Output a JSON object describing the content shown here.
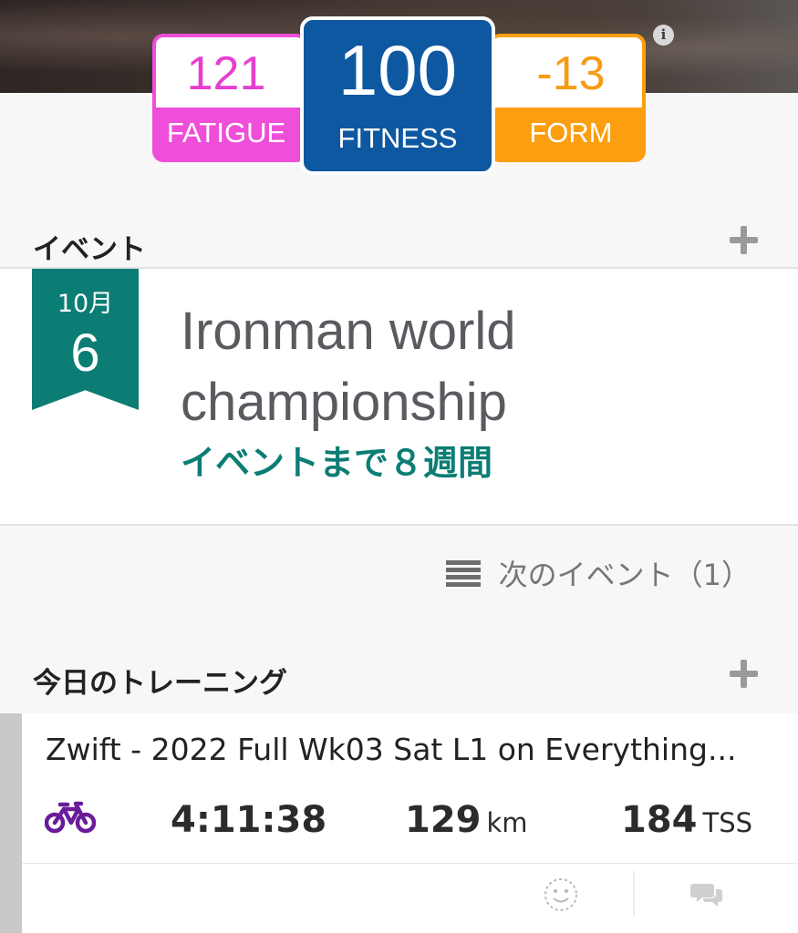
{
  "metrics": {
    "fatigue": {
      "value": "121",
      "label": "FATIGUE",
      "color": "#ee4ed8"
    },
    "fitness": {
      "value": "100",
      "label": "FITNESS",
      "color": "#0e58a1"
    },
    "form": {
      "value": "-13",
      "label": "FORM",
      "color": "#fb9e0f"
    },
    "info_icon": "info-icon"
  },
  "events": {
    "section_title": "イベント",
    "add_icon": "plus-icon",
    "card": {
      "month": "10月",
      "day": "6",
      "name": "Ironman world championship",
      "countdown": "イベントまで８週間",
      "accent_color": "#0c7d74"
    },
    "next_events_label": "次のイベント（1）",
    "list_icon": "list-icon"
  },
  "training": {
    "section_title": "今日のトレーニング",
    "add_icon": "plus-icon",
    "workout": {
      "title": "Zwift - 2022 Full Wk03 Sat L1 on Everything...",
      "sport_icon": "bike-icon",
      "sport_color": "#6a1b9a",
      "duration": "4:11:38",
      "distance": "129",
      "distance_unit": "km",
      "tss": "184",
      "tss_unit": "TSS",
      "feel_icon": "smiley-icon",
      "comments_icon": "comments-icon"
    }
  }
}
